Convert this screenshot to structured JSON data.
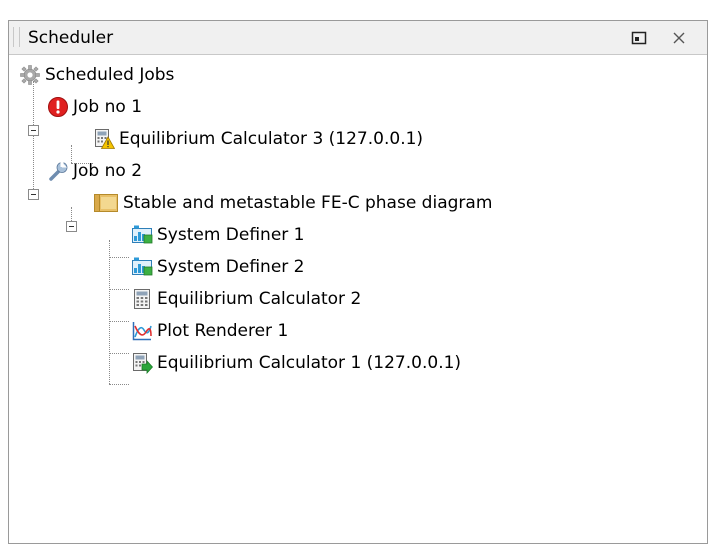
{
  "panel": {
    "title": "Scheduler",
    "restore_icon": "restore-window-icon",
    "close_icon": "close-icon",
    "close_symbol": "✕"
  },
  "tree": {
    "root": {
      "label": "Scheduled Jobs",
      "icon": "gear-icon"
    },
    "jobs": [
      {
        "label": "Job no 1",
        "icon": "error-icon",
        "expanded": true,
        "children": [
          {
            "label": "Equilibrium Calculator 3 (127.0.0.1)",
            "icon": "calculator-warning-icon"
          }
        ]
      },
      {
        "label": "Job no 2",
        "icon": "wrench-icon",
        "expanded": true,
        "children": [
          {
            "label": "Stable and metastable FE-C phase diagram",
            "icon": "folder-icon",
            "expanded": true,
            "children": [
              {
                "label": "System Definer 1",
                "icon": "system-definer-icon"
              },
              {
                "label": "System Definer 2",
                "icon": "system-definer-icon"
              },
              {
                "label": "Equilibrium Calculator 2",
                "icon": "calculator-icon"
              },
              {
                "label": "Plot Renderer 1",
                "icon": "plot-renderer-icon"
              },
              {
                "label": "Equilibrium Calculator 1 (127.0.0.1)",
                "icon": "calculator-running-icon"
              }
            ]
          }
        ]
      }
    ]
  },
  "colors": {
    "error": "#e02020",
    "folder": "#e8c068",
    "warning": "#f5c400",
    "system_definer": "#2e9ad8",
    "running_arrow": "#2aa63a"
  }
}
